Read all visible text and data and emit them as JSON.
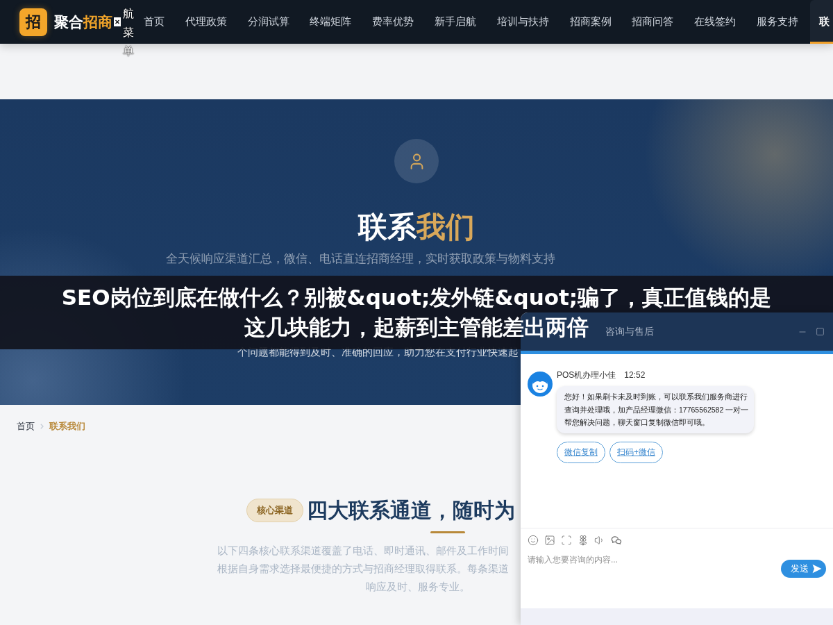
{
  "nav": {
    "logo_mark": "招",
    "logo": {
      "text": "聚合",
      "highlight": "招商"
    },
    "menu_label": "航菜单",
    "items": [
      {
        "label": "首页",
        "selected": false
      },
      {
        "label": "代理政策",
        "selected": false
      },
      {
        "label": "分润试算",
        "selected": false
      },
      {
        "label": "终端矩阵",
        "selected": false
      },
      {
        "label": "费率优势",
        "selected": false
      },
      {
        "label": "新手启航",
        "selected": false
      },
      {
        "label": "培训与扶持",
        "selected": false
      },
      {
        "label": "招商案例",
        "selected": false
      },
      {
        "label": "招商问答",
        "selected": false
      },
      {
        "label": "在线签约",
        "selected": false
      },
      {
        "label": "服务支持",
        "selected": false
      },
      {
        "label": "联",
        "selected": true
      }
    ]
  },
  "hero": {
    "title": {
      "text": "联系",
      "highlight": "我们"
    },
    "subtitle": "全天候响应渠道汇总，微信、电话直连招商经理，实时获取政策与物料支持",
    "tail": "个问题都能得到及时、准确的回应，助力您在支付行业快速起"
  },
  "banner": {
    "title_lines": [
      "SEO岗位到底在做什么？别被&quot;发外链&quot;骗了，真正值钱的是",
      "这几块能力，起薪到主管能差出两倍"
    ]
  },
  "breadcrumb": [
    {
      "label": "首页",
      "selected": false
    },
    {
      "label": "联系我们",
      "selected": true
    }
  ],
  "channels_section": {
    "badge": "核心渠道",
    "heading": "四大联系通道，随时为",
    "lines": [
      "以下四条核心联系渠道覆盖了电话、即时通讯、邮件及工作时间",
      "根据自身需求选择最便捷的方式与招商经理取得联系。每条渠道",
      "响应及时、服务专业。"
    ]
  },
  "chat": {
    "title": "咨询与售后",
    "message": {
      "sender": "POS机办理小佳",
      "time": "12:52",
      "text": "您好！如果刷卡未及时到账，可以联系我们服务商进行查询并处理哦，加产品经理微信：17765562582 一对一帮您解决问题，聊天窗口复制微信即可哦。",
      "actions": [
        "微信复制",
        "扫码+微信"
      ]
    },
    "input": {
      "placeholder": "请输入您要咨询的内容..."
    },
    "send": "发送"
  }
}
